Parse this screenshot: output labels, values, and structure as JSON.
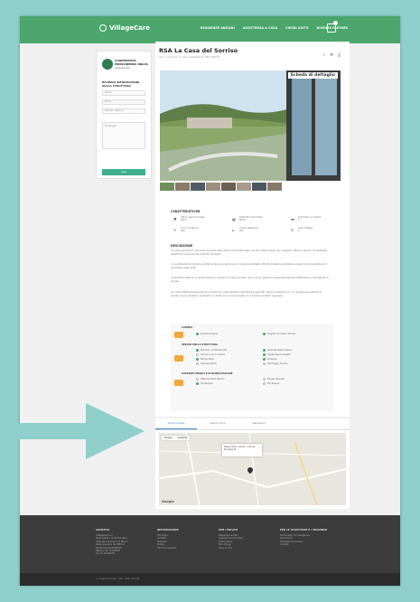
{
  "header": {
    "logo": "VillageCare",
    "nav": [
      "RESIDENZE ANZIANI",
      "ASSISTENZA A CASA",
      "CHIEDI AIUTO",
      "DIVENTA PARTNER"
    ]
  },
  "sidebar": {
    "org_name": "COOPERATIVA PROVVIDENZA ONLUS",
    "org_sub": "professionisti",
    "form_title": "RICHIEDI INFORMAZIONI SULLA STRUTTURA",
    "fields": [
      "Nome",
      "Email",
      "Numero telefono",
      "Messaggio"
    ],
    "select_placeholder": "Nome",
    "button": "Invia"
  },
  "main": {
    "title": "RSA La Casa del Sorriso",
    "subtitle": "Via L. Da Vinci 2, San Sebastiano (MI) 20075",
    "badge": "Scheda di dettaglio",
    "features_head": "CARATTERISTICHE",
    "features": [
      {
        "label": "Ultimo aggiornamento",
        "value": "2019"
      },
      {
        "label": "Posti letto autorizzati",
        "value": "60/75"
      },
      {
        "label": "Posti letto accreditati",
        "value": "0"
      },
      {
        "label": "Tipo di struttura",
        "value": "RSA"
      },
      {
        "label": "Livello assistenza",
        "value": "Alto"
      },
      {
        "label": "Lista d'attesa",
        "value": "0"
      }
    ],
    "description_head": "DESCRIZIONE",
    "description": [
      "\"La Casa del Sorriso\" immersa nel verde della città di Monte Barcaglia, ma allo stesso tempo ben collegata. Offre un servizio di assistenza qualificato con personale dedicato all'ospite.",
      "In un ambiente accogliente, la RSA propone un percorso di cura personalizzato, attività ricreative quotidiane e spazi comuni studiati per il benessere degli ospiti.",
      "La struttura dispone di camere doppie e singole con bagno privato, sale comuni, giardino e aree dedicate alla riabilitazione e alle attività di gruppo.",
      "La nostra offerta prevede servizi di medicina, infermieristica e fisioterapia garantiti nell'arco delle 24 ore, con la presenza costante di operatori socio sanitari e animatori. La struttura è convenzionata con il servizio sanitario regionale."
    ],
    "amenities": [
      {
        "head": "CAMERA",
        "items": [
          [
            "Camera Singola",
            true
          ],
          [
            "Singola con bagno Privato",
            true
          ]
        ]
      },
      {
        "head": "SERVIZI DELLA STRUTTURA",
        "items": [
          [
            "Giardino / Cortile Privato",
            true
          ],
          [
            "Spazi Ricreativi Interni",
            true
          ],
          [
            "Cucina e Cuoco Interni",
            false
          ],
          [
            "Trasferimenti Assistiti",
            true
          ],
          [
            "Parrucchiere",
            true
          ],
          [
            "Podologo",
            true
          ],
          [
            "Internet (Wi-Fi)",
            false
          ],
          [
            "Parcheggio Privato",
            false
          ]
        ]
      },
      {
        "head": "SUPPORTI MEDICI E DI RIABILITAZIONE",
        "items": [
          [
            "Infermieristica Medica",
            false
          ],
          [
            "Terapie Speciali",
            false
          ],
          [
            "Fisioterapia",
            true
          ],
          [
            "Fisi Terapia",
            false
          ]
        ]
      }
    ]
  },
  "map_section": {
    "tabs": [
      "Come Arrivare",
      "Servizi Vicini",
      "Recensioni"
    ],
    "map_type": [
      "Mappa",
      "Satellite"
    ],
    "popup": "Piazza Vittorio Veneto, 1 Monte Barcaglia MI",
    "google": "Google"
  },
  "footer": {
    "columns": [
      {
        "head": "CONTATTI",
        "lines": [
          "VillageCare S.r.l.",
          "Sede legale e amministrativa",
          "Viale del Commercio 8 Milano",
          "Sede operativa Via Vittorio",
          "Partita IVA 0123456789",
          "",
          "Telefono 02 12345678",
          "Fax 02 12345678"
        ]
      },
      {
        "head": "INFORMAZIONI",
        "lines": [
          "Chi siamo",
          "Contatti",
          "Supporto",
          "Privacy",
          "Termini di servizio"
        ]
      },
      {
        "head": "PER I PRIVATI",
        "lines": [
          "Residenze Anziani",
          "Assistenza Domiciliare",
          "Centri Diurni",
          "Mini Alloggi",
          "Case di Cura"
        ]
      },
      {
        "head": "PER LE STRUTTURE E I PROVIDER",
        "lines": [
          "Partnership con VillageCare",
          "Iscriviti Ora",
          "Condizioni di servizio",
          "Contatti"
        ]
      }
    ],
    "copyright": "© VillageCare 2019 - Tutti i diritti riservati"
  },
  "colors": {
    "brand_green": "#4aa66b",
    "teal_bg": "#8ecfcc",
    "accent_orange": "#f1a93b"
  }
}
